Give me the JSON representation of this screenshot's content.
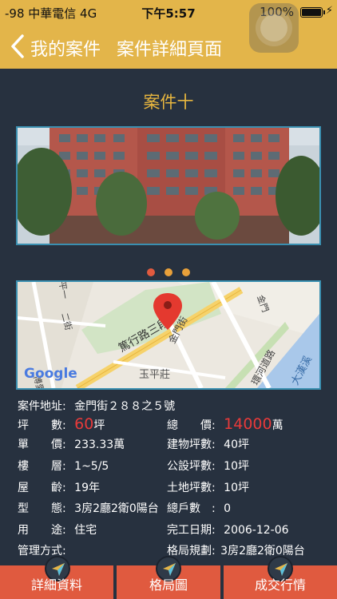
{
  "status_bar": {
    "carrier": "-98 中華電信  4G",
    "time": "下午5:57",
    "battery": "100%"
  },
  "nav": {
    "back_label": "我的案件",
    "title": "案件詳細頁面"
  },
  "case": {
    "name": "案件十"
  },
  "map": {
    "labels": {
      "road1": "篤行路三段",
      "road2": "金門街",
      "road3": "環河道路",
      "road4": "大漢溪",
      "road5": "博愛",
      "road6": "二街",
      "place": "玉平莊",
      "brand": "Google",
      "road7": "金門",
      "road8": "平一"
    }
  },
  "details": {
    "address_label": "案件地址:",
    "address_value": "金門街２８８之５號",
    "ping_label": "坪　　數:",
    "ping_value": "60",
    "ping_unit": "坪",
    "total_label": "總　　價:",
    "total_value": "14000",
    "total_unit": "萬",
    "unit_price_label": "單　　價:",
    "unit_price_value": "233.33萬",
    "building_ping_label": "建物坪數:",
    "building_ping_value": "40坪",
    "floor_label": "樓　　層:",
    "floor_value": "1~5/5",
    "public_ping_label": "公設坪數:",
    "public_ping_value": "10坪",
    "age_label": "屋　　齡:",
    "age_value": "19年",
    "land_ping_label": "土地坪數:",
    "land_ping_value": "10坪",
    "type_label": "型　　態:",
    "type_value": "3房2廳2衛0陽台",
    "households_label": "總戶數　:",
    "households_value": "0",
    "usage_label": "用　　途:",
    "usage_value": "住宅",
    "completed_label": "完工日期:",
    "completed_value": "2006-12-06",
    "mgmt_label": "管理方式:",
    "layout_label": "格局規劃:",
    "layout_value": "3房2廳2衛0陽台"
  },
  "tabs": [
    {
      "label": "詳細資料"
    },
    {
      "label": "格局圖"
    },
    {
      "label": "成交行情"
    }
  ],
  "colors": {
    "accent": "#e3b54a",
    "background": "#27313f",
    "highlight": "#e83a3a",
    "tab": "#e05a3f",
    "frame": "#3a8fb0"
  },
  "pager": {
    "active_index": 0,
    "count": 3
  }
}
